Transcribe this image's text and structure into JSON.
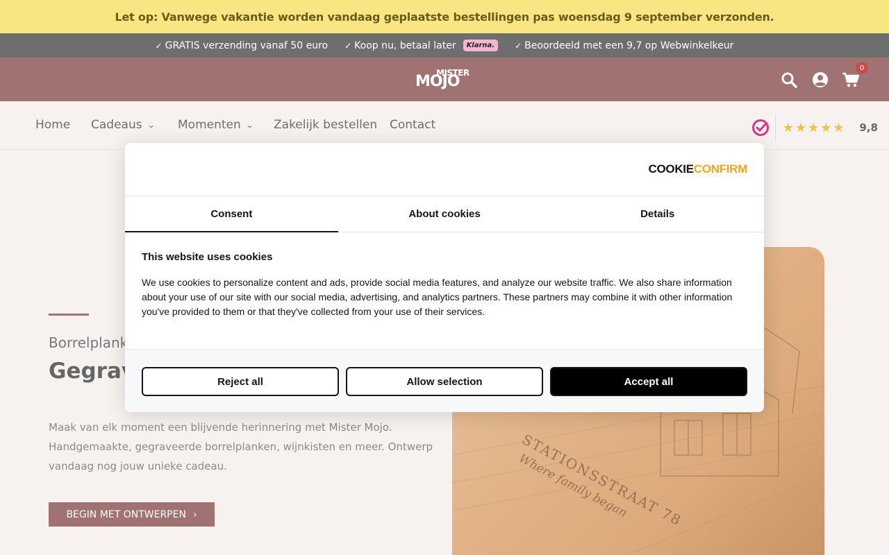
{
  "announcement": "Let op: Vanwege vakantie worden vandaag geplaatste bestellingen pas woensdag 9 september verzonden.",
  "usp": {
    "items": [
      "GRATIS verzending vanaf 50 euro",
      "Koop nu, betaal later",
      "Beoordeeld met een 9,7 op Webwinkelkeur"
    ],
    "klarna": "Klarna."
  },
  "header": {
    "logo_line1": "MISTER",
    "logo_line2": "MOJO",
    "cart_count": "0",
    "icons": [
      "search-icon",
      "account-icon",
      "cart-icon"
    ]
  },
  "nav": {
    "items": [
      "Home",
      "Cadeaus",
      "Momenten",
      "Zakelijk bestellen",
      "Contact"
    ],
    "rating_stars": "★★★★★",
    "rating_score": "9,8"
  },
  "hero": {
    "subtitle": "Borrelplank",
    "title": "Gegrav meer",
    "text": "Maak van elk moment een blijvende herinnering met Mister Mojo. Handgemaakte, gegraveerde borrelplanken, wijnkisten en meer. Ontwerp vandaag nog jouw unieke cadeau.",
    "button": "BEGIN MET ONTWERPEN",
    "engraving_1": "STATIONSSTRAAT 78",
    "engraving_2": "Where family began"
  },
  "cookie": {
    "brand_a": "COOKIE",
    "brand_b": "CONFIRM",
    "tabs": [
      "Consent",
      "About cookies",
      "Details"
    ],
    "title": "This website uses cookies",
    "body": "We use cookies to personalize content and ads, provide social media features, and analyze our website traffic. We also share information about your use of our site with our social media, advertising, and analytics partners. These partners may combine it with other information you've provided to them or that they've collected from your use of their services.",
    "reject": "Reject all",
    "allow": "Allow selection",
    "accept": "Accept all"
  },
  "colors": {
    "announcement_bg": "#f7e681",
    "usp_bg": "#6e6e6e",
    "brand": "#a07272",
    "cookie_accent": "#f0a81b"
  }
}
